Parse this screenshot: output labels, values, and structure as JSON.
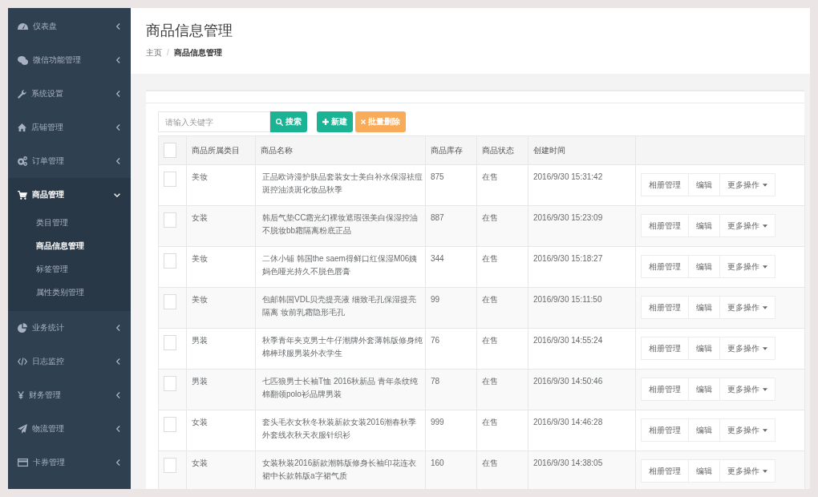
{
  "sidebar": {
    "items": [
      {
        "label": "仪表盘",
        "selected": false,
        "expanded": false
      },
      {
        "label": "微信功能管理",
        "selected": false,
        "expanded": false
      },
      {
        "label": "系统设置",
        "selected": false,
        "expanded": false
      },
      {
        "label": "店铺管理",
        "selected": false,
        "expanded": false
      },
      {
        "label": "订单管理",
        "selected": false,
        "expanded": false
      },
      {
        "label": "商品管理",
        "selected": true,
        "expanded": true,
        "children": [
          {
            "label": "类目管理",
            "selected": false
          },
          {
            "label": "商品信息管理",
            "selected": true
          },
          {
            "label": "标签管理",
            "selected": false
          },
          {
            "label": "属性类别管理",
            "selected": false
          }
        ]
      },
      {
        "label": "业务统计",
        "selected": false,
        "expanded": false
      },
      {
        "label": "日志监控",
        "selected": false,
        "expanded": false
      },
      {
        "label": "财务管理",
        "selected": false,
        "expanded": false
      },
      {
        "label": "物流管理",
        "selected": false,
        "expanded": false
      },
      {
        "label": "卡券管理",
        "selected": false,
        "expanded": false
      }
    ]
  },
  "header": {
    "title": "商品信息管理",
    "separator": "/",
    "breadcrumb": [
      {
        "label": "主页",
        "current": false
      },
      {
        "label": "商品信息管理",
        "current": true
      }
    ]
  },
  "toolbar": {
    "search": {
      "placeholder": "请输入关键字"
    },
    "buttons": [
      {
        "label": "搜索",
        "kind": "search"
      },
      {
        "label": "新建",
        "kind": "create"
      },
      {
        "label": "批量删除",
        "kind": "delete"
      }
    ]
  },
  "table": {
    "header_checkbox": {
      "checked": false
    },
    "columns": [
      "商品所属类目",
      "商品名称",
      "商品库存",
      "商品状态",
      "创建时间"
    ],
    "rows": [
      {
        "checked": false,
        "category": "美妆",
        "name": "正品欧诗漫护肤品套装女士美白补水保湿祛痘斑控油淡斑化妆品秋季",
        "stock": "875",
        "status": "在售",
        "created": "2016/9/30 15:31:42",
        "actions": [
          "相册管理",
          "编辑"
        ],
        "dropdown": "更多操作"
      },
      {
        "checked": false,
        "category": "女装",
        "name": "韩后气垫CC霜光幻裸妆遮瑕强美白保湿控油不脱妆bb霜隔离粉底正品",
        "stock": "887",
        "status": "在售",
        "created": "2016/9/30 15:23:09",
        "actions": [
          "相册管理",
          "编辑"
        ],
        "dropdown": "更多操作"
      },
      {
        "checked": false,
        "category": "美妆",
        "name": "二休小铺 韩国the saem得鲜口红保湿M06姨妈色哑光持久不脱色唇膏",
        "stock": "344",
        "status": "在售",
        "created": "2016/9/30 15:18:27",
        "actions": [
          "相册管理",
          "编辑"
        ],
        "dropdown": "更多操作"
      },
      {
        "checked": false,
        "category": "美妆",
        "name": "包邮韩国VDL贝壳提亮液 细致毛孔保湿提亮隔离 妆前乳霜隐形毛孔",
        "stock": "99",
        "status": "在售",
        "created": "2016/9/30 15:11:50",
        "actions": [
          "相册管理",
          "编辑"
        ],
        "dropdown": "更多操作"
      },
      {
        "checked": false,
        "category": "男装",
        "name": "秋季青年夹克男士牛仔潮牌外套薄韩版修身纯棉棒球服男装外衣学生",
        "stock": "76",
        "status": "在售",
        "created": "2016/9/30 14:55:24",
        "actions": [
          "相册管理",
          "编辑"
        ],
        "dropdown": "更多操作"
      },
      {
        "checked": false,
        "category": "男装",
        "name": "七匹狼男士长袖T恤 2016秋新品 青年条纹纯棉翻领polo衫品牌男装",
        "stock": "78",
        "status": "在售",
        "created": "2016/9/30 14:50:46",
        "actions": [
          "相册管理",
          "编辑"
        ],
        "dropdown": "更多操作"
      },
      {
        "checked": false,
        "category": "女装",
        "name": "套头毛衣女秋冬秋装新款女装2016潮春秋季外套线衣秋天衣服针织衫",
        "stock": "999",
        "status": "在售",
        "created": "2016/9/30 14:46:28",
        "actions": [
          "相册管理",
          "编辑"
        ],
        "dropdown": "更多操作"
      },
      {
        "checked": false,
        "category": "女装",
        "name": "女装秋装2016新款潮韩版修身长袖印花连衣裙中长款韩版a字裙气质",
        "stock": "160",
        "status": "在售",
        "created": "2016/9/30 14:38:05",
        "actions": [
          "相册管理",
          "编辑"
        ],
        "dropdown": "更多操作"
      }
    ]
  }
}
